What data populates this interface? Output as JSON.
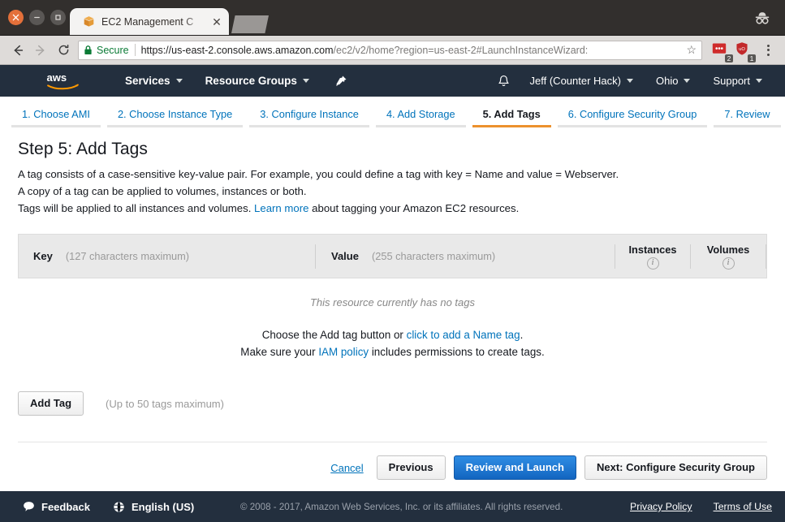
{
  "browser": {
    "tab": {
      "title": "EC2 Management C",
      "favicon_icon": "box-icon",
      "close_icon": "close-icon"
    },
    "new_tab_icon": "new-tab-icon",
    "incognito_icon": "incognito-icon",
    "back_icon": "back-arrow-icon",
    "forward_icon": "forward-arrow-icon",
    "reload_icon": "reload-icon",
    "lock_icon": "lock-icon",
    "secure_label": "Secure",
    "url_host": "https://us-east-2.console.aws.amazon.com",
    "url_path": "/ec2/v2/home?region=us-east-2#LaunchInstanceWizard:",
    "bookmark_icon": "star-icon",
    "menu_icon": "kebab-menu-icon",
    "extensions": [
      {
        "name": "ellipsis-extension-icon",
        "badge": "2"
      },
      {
        "name": "shield-extension-icon",
        "badge": "1"
      }
    ]
  },
  "nav": {
    "logo_icon": "aws-logo-icon",
    "services": "Services",
    "resource_groups": "Resource Groups",
    "pin_icon": "pin-icon",
    "bell_icon": "bell-icon",
    "account": "Jeff (Counter Hack)",
    "region": "Ohio",
    "support": "Support"
  },
  "steps": [
    {
      "label": "1. Choose AMI",
      "active": false
    },
    {
      "label": "2. Choose Instance Type",
      "active": false
    },
    {
      "label": "3. Configure Instance",
      "active": false
    },
    {
      "label": "4. Add Storage",
      "active": false
    },
    {
      "label": "5. Add Tags",
      "active": true
    },
    {
      "label": "6. Configure Security Group",
      "active": false
    },
    {
      "label": "7. Review",
      "active": false
    }
  ],
  "main": {
    "title": "Step 5: Add Tags",
    "desc_line1": "A tag consists of a case-sensitive key-value pair. For example, you could define a tag with key = Name and value = Webserver.",
    "desc_line2": "A copy of a tag can be applied to volumes, instances or both.",
    "desc_line3_pre": "Tags will be applied to all instances and volumes.",
    "desc_learn_more": "Learn more",
    "desc_line3_post": "about tagging your Amazon EC2 resources.",
    "table": {
      "key_label": "Key",
      "key_hint": "(127 characters maximum)",
      "value_label": "Value",
      "value_hint": "(255 characters maximum)",
      "instances_label": "Instances",
      "volumes_label": "Volumes",
      "info_icon": "info-icon"
    },
    "empty_note": "This resource currently has no tags",
    "empty_line1_pre": "Choose the Add tag button or",
    "empty_line1_link": "click to add a Name tag",
    "empty_line1_post": ".",
    "empty_line2_pre": "Make sure your",
    "empty_line2_link": "IAM policy",
    "empty_line2_post": "includes permissions to create tags.",
    "add_tag_button": "Add Tag",
    "add_tag_hint": "(Up to 50 tags maximum)"
  },
  "actions": {
    "cancel": "Cancel",
    "previous": "Previous",
    "review_launch": "Review and Launch",
    "next": "Next: Configure Security Group"
  },
  "footer": {
    "feedback": "Feedback",
    "feedback_icon": "speech-bubble-icon",
    "language": "English (US)",
    "language_icon": "globe-icon",
    "copyright": "© 2008 - 2017, Amazon Web Services, Inc. or its affiliates. All rights reserved.",
    "privacy": "Privacy Policy",
    "terms": "Terms of Use"
  },
  "colors": {
    "aws_navy": "#232f3e",
    "aws_orange": "#ec912d",
    "link_blue": "#0073bb",
    "primary_button": "#1265c0"
  }
}
